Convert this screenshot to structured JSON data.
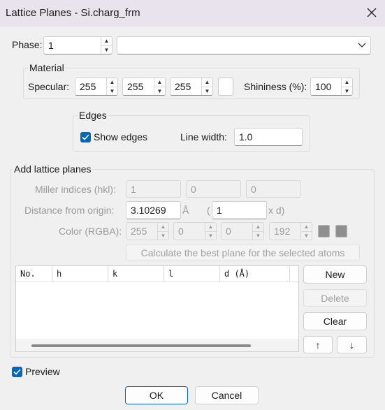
{
  "window": {
    "title": "Lattice Planes - Si.charg_frm"
  },
  "phase": {
    "label": "Phase:",
    "value": "1",
    "dropdown_value": ""
  },
  "material": {
    "title": "Material",
    "specular_label": "Specular:",
    "specular": [
      "255",
      "255",
      "255"
    ],
    "shininess_label": "Shininess (%):",
    "shininess": "100"
  },
  "edges": {
    "title": "Edges",
    "show_edges_label": "Show edges",
    "show_edges_checked": true,
    "line_width_label": "Line width:",
    "line_width": "1.0"
  },
  "add_planes": {
    "title": "Add lattice planes",
    "miller_label": "Miller indices (hkl):",
    "miller": [
      "1",
      "0",
      "0"
    ],
    "distance_label": "Distance from origin:",
    "distance": "3.10269",
    "distance_unit": "Å",
    "paren_open": "(",
    "multiplier": "1",
    "multiplier_suffix": "x d)",
    "color_label": "Color (RGBA):",
    "color": [
      "255",
      "0",
      "0",
      "192"
    ],
    "calc_button": "Calculate the best plane for the selected atoms",
    "table_headers": [
      "No.",
      "h",
      "k",
      "l",
      "d (Å)"
    ],
    "table_rows": [],
    "new_button": "New",
    "delete_button": "Delete",
    "clear_button": "Clear",
    "up_button": "↑",
    "down_button": "↓"
  },
  "preview": {
    "label": "Preview",
    "checked": true
  },
  "footer": {
    "ok": "OK",
    "cancel": "Cancel"
  },
  "icons": {
    "close": "close-icon",
    "dropdown": "chevron-down-icon",
    "check": "check-icon"
  }
}
